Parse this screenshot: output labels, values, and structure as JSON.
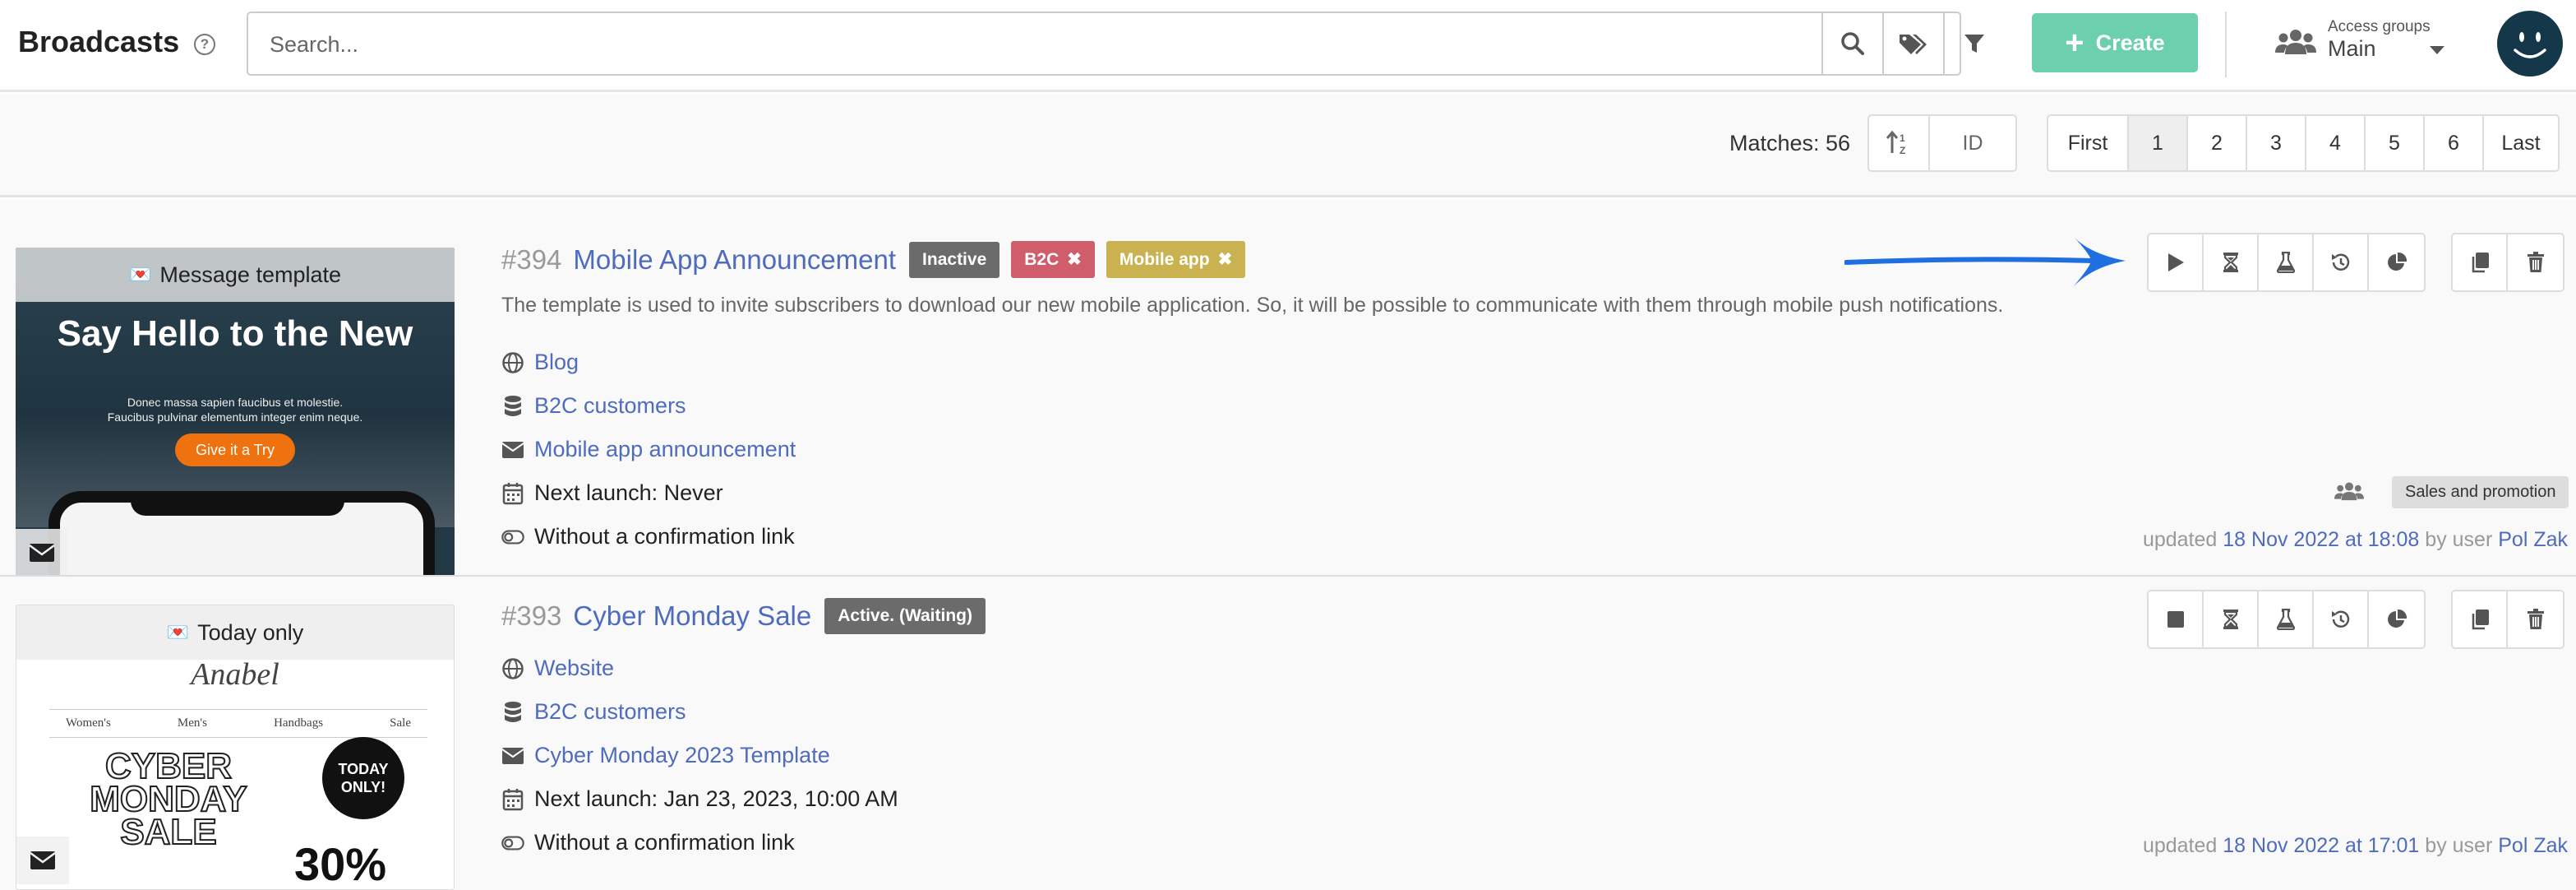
{
  "header": {
    "title": "Broadcasts",
    "help_icon": "question-circle-icon",
    "search_placeholder": "Search...",
    "create_label": "Create",
    "access_groups_label": "Access groups",
    "access_groups_value": "Main"
  },
  "toolbar": {
    "matches": "Matches: 56",
    "sort_id_label": "ID",
    "pagination": [
      "First",
      "1",
      "2",
      "3",
      "4",
      "5",
      "6",
      "Last"
    ],
    "active_page": "1"
  },
  "broadcasts": [
    {
      "number": "#394",
      "name": "Mobile App Announcement",
      "status": "Inactive",
      "tags": [
        {
          "label": "B2C",
          "color": "#d05d6b"
        },
        {
          "label": "Mobile app",
          "color": "#c9b24f"
        }
      ],
      "description": "The template is used to invite subscribers to download our new mobile application. So, it will be possible to communicate with them through mobile push notifications.",
      "thumb_label": "Message template",
      "thumb_hero": "Say Hello to the New",
      "thumb_sub1": "Donec massa sapien faucibus et molestie.",
      "thumb_sub2": "Faucibus pulvinar elementum integer enim neque.",
      "thumb_button": "Give it a Try",
      "source": "Blog",
      "segment": "B2C customers",
      "template": "Mobile app announcement",
      "next_launch": "Next launch: Never",
      "confirmation": "Without a confirmation link",
      "group_tag": "Sales and promotion",
      "updated_prefix": "updated",
      "updated_date": "18 Nov 2022 at 18:08",
      "updated_by": "by user",
      "updated_user": "Pol Zak"
    },
    {
      "number": "#393",
      "name": "Cyber Monday Sale",
      "status": "Active. (Waiting)",
      "thumb_label": "Today only",
      "thumb_brand": "Anabel",
      "thumb_nav": [
        "Women's",
        "Men's",
        "Handbags",
        "Sale"
      ],
      "thumb_hero": "CYBER MONDAY SALE",
      "thumb_circle": "TODAY ONLY!",
      "thumb_percent": "30%",
      "source": "Website",
      "segment": "B2C customers",
      "template": "Cyber Monday 2023 Template",
      "next_launch": "Next launch: Jan 23, 2023, 10:00 AM",
      "confirmation": "Without a confirmation link",
      "updated_prefix": "updated",
      "updated_date": "18 Nov 2022 at 17:01",
      "updated_by": "by user",
      "updated_user": "Pol Zak"
    }
  ],
  "colors": {
    "create": "#6ccfad",
    "link": "#4f6bbd",
    "status_badge": "#6b6b6b",
    "arrow": "#1f6fe0"
  }
}
